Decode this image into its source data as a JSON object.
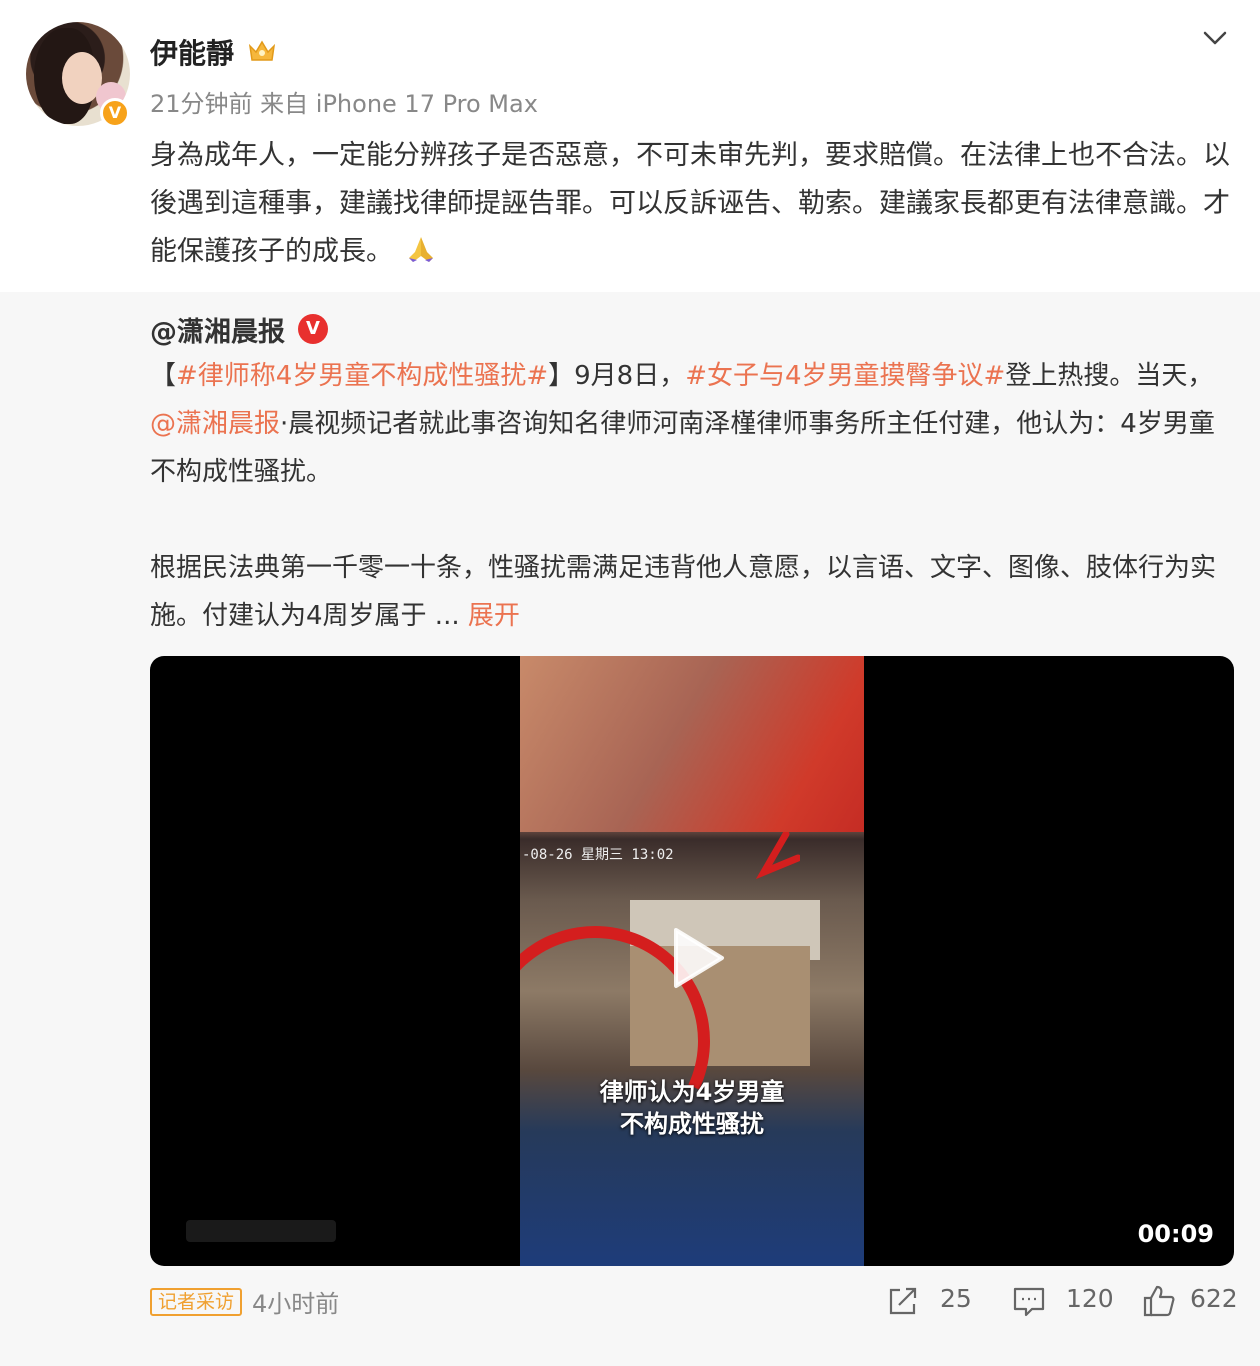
{
  "post": {
    "author": "伊能靜",
    "author_badge_icon": "crown-icon",
    "verify_icon": "verified-v-icon",
    "meta": "21分钟前  来自 iPhone 17 Pro Max",
    "text": "身為成年人，一定能分辨孩子是否惡意，不可未审先判，要求賠償。在法律上也不合法。以後遇到這種事，建議找律師提誣告罪。可以反訴诬告、勒索。建議家長都更有法律意識。才能保護孩子的成長。",
    "emoji_icon": "pray-hands-icon"
  },
  "repost": {
    "author": "@潇湘晨报",
    "text_open_bracket": "【",
    "tag1": "#律师称4岁男童不构成性骚扰#",
    "text_close_bracket": "】9月8日，",
    "tag2": "#女子与4岁男童摸臀争议#",
    "text_after_tag2": "登上热搜。当天，",
    "mention": "@潇湘晨报",
    "text_after_mention": "·晨视频记者就此事咨询知名律师河南泽槿律师事务所主任付建，他认为：4岁男童不构成性骚扰。",
    "para2": "根据民法典第一千零一十条，性骚扰需满足违背他人意愿，以言语、文字、图像、肢体行为实施。付建认为4周岁属于",
    "ellipsis": " ... ",
    "expand": "展开"
  },
  "video": {
    "cam_timestamp": "-08-26  星期三  13:02",
    "caption_line1": "律师认为4岁男童",
    "caption_line2": "不构成性骚扰",
    "duration": "00:09"
  },
  "footer": {
    "source_tag": "记者采访",
    "time": "4小时前",
    "reposts": "25",
    "comments": "120",
    "likes": "622"
  },
  "colors": {
    "accent": "#eb7350",
    "verified_orange": "#f7a21a",
    "verified_red": "#e8302e"
  }
}
